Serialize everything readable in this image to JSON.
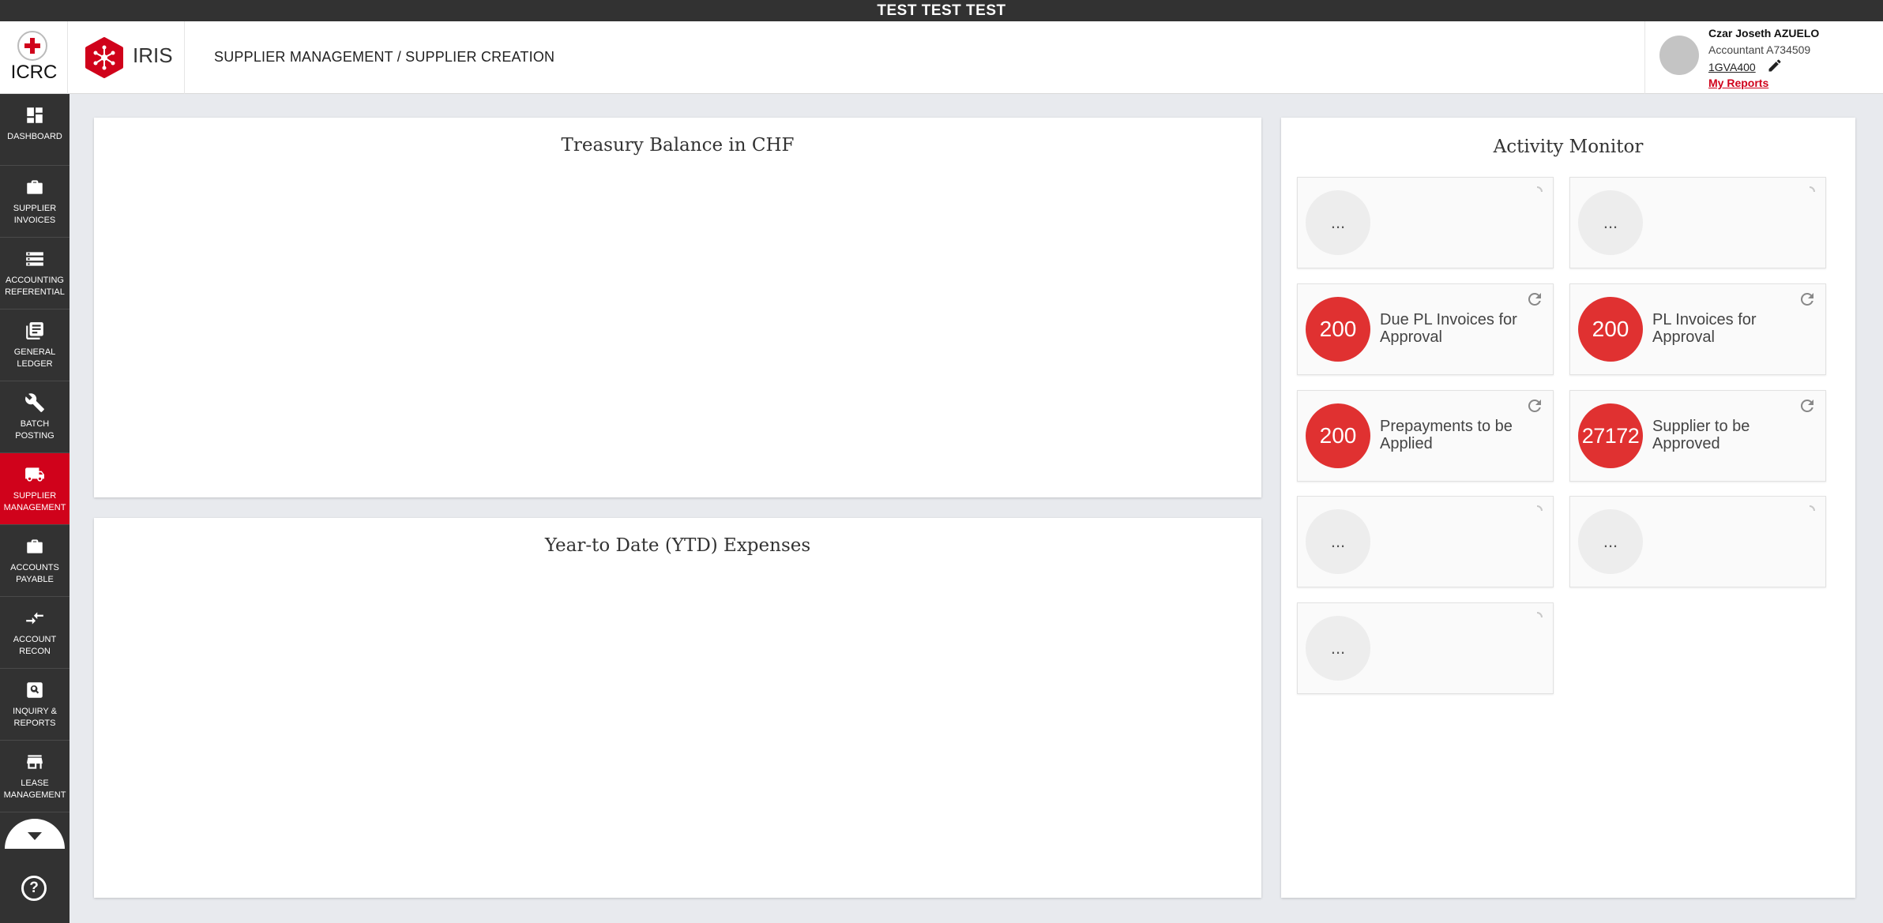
{
  "banner": {
    "text": "TEST TEST TEST"
  },
  "header": {
    "org_name": "ICRC",
    "app_name": "IRIS",
    "breadcrumb": "SUPPLIER MANAGEMENT / SUPPLIER CREATION"
  },
  "user": {
    "name": "Czar Joseth AZUELO",
    "role": "Accountant A734509",
    "code": "1GVA400",
    "reports_link": "My Reports"
  },
  "sidebar": {
    "items": [
      {
        "label": "DASHBOARD",
        "icon": "dashboard-icon",
        "active": false
      },
      {
        "label": "SUPPLIER INVOICES",
        "icon": "briefcase-icon",
        "active": false
      },
      {
        "label": "ACCOUNTING REFERENTIAL",
        "icon": "storage-icon",
        "active": false
      },
      {
        "label": "GENERAL LEDGER",
        "icon": "ledger-icon",
        "active": false
      },
      {
        "label": "BATCH POSTING",
        "icon": "wrench-icon",
        "active": false
      },
      {
        "label": "SUPPLIER MANAGEMENT",
        "icon": "truck-icon",
        "active": true
      },
      {
        "label": "ACCOUNTS PAYABLE",
        "icon": "briefcase-icon",
        "active": false
      },
      {
        "label": "ACCOUNT RECON",
        "icon": "compare-arrows-icon",
        "active": false
      },
      {
        "label": "INQUIRY & REPORTS",
        "icon": "search-doc-icon",
        "active": false
      },
      {
        "label": "LEASE MANAGEMENT",
        "icon": "store-icon",
        "active": false
      }
    ],
    "help_glyph": "?"
  },
  "panels": {
    "treasury_title": "Treasury Balance in CHF",
    "ytd_title": "Year-to Date (YTD) Expenses",
    "activity_title": "Activity Monitor"
  },
  "activity": {
    "tiles": [
      {
        "value": "...",
        "label": "",
        "state": "loading"
      },
      {
        "value": "...",
        "label": "",
        "state": "loading"
      },
      {
        "value": "200",
        "label": "Due PL Invoices for Approval",
        "state": "loaded"
      },
      {
        "value": "200",
        "label": "PL Invoices for Approval",
        "state": "loaded"
      },
      {
        "value": "200",
        "label": "Prepayments to be Applied",
        "state": "loaded"
      },
      {
        "value": "27172",
        "label": "Supplier to be Approved",
        "state": "loaded"
      },
      {
        "value": "...",
        "label": "",
        "state": "loading"
      },
      {
        "value": "...",
        "label": "",
        "state": "loading"
      },
      {
        "value": "...",
        "label": "",
        "state": "loading"
      }
    ]
  },
  "colors": {
    "brand_red": "#d0021b",
    "count_red": "#e03131",
    "sidebar_bg": "#323232",
    "page_bg": "#e8eaee"
  }
}
